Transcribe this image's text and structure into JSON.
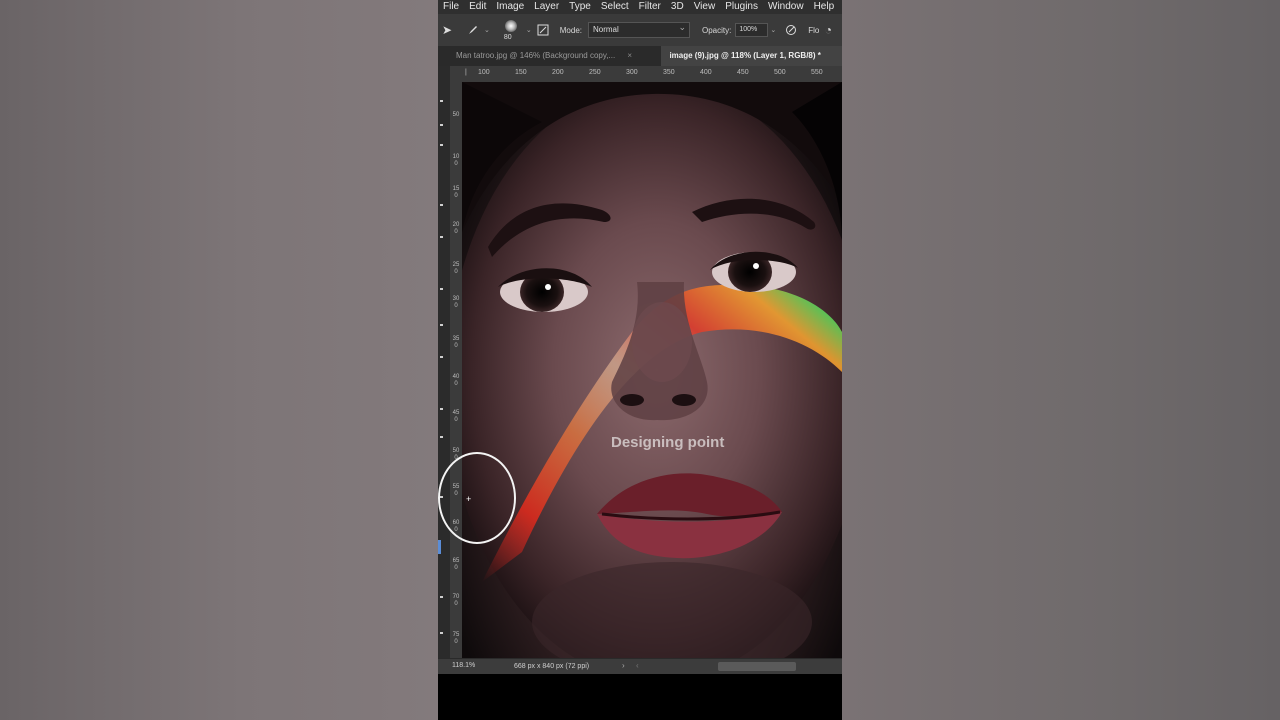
{
  "menubar": {
    "items": [
      "File",
      "Edit",
      "Image",
      "Layer",
      "Type",
      "Select",
      "Filter",
      "3D",
      "View",
      "Plugins",
      "Window",
      "Help"
    ],
    "minimize": "—"
  },
  "options": {
    "brush_size": "80",
    "mode_label": "Mode:",
    "mode_value": "Normal",
    "opacity_label": "Opacity:",
    "opacity_value": "100%",
    "flow_label": "Flo"
  },
  "tabs": [
    {
      "label": "Man tatroo.jpg @ 146% (Background copy,...",
      "close": "×",
      "active": false
    },
    {
      "label": "image (9).jpg @ 118% (Layer 1, RGB/8) *",
      "active": true
    }
  ],
  "ruler_top": [
    "100",
    "150",
    "200",
    "250",
    "300",
    "350",
    "400",
    "450",
    "500",
    "550"
  ],
  "ruler_left": [
    "50",
    "100",
    "150",
    "200",
    "250",
    "300",
    "350",
    "400",
    "450",
    "500",
    "550",
    "600",
    "650",
    "700",
    "750"
  ],
  "canvas": {
    "watermark": "Designing point"
  },
  "statusbar": {
    "zoom": "118.1%",
    "doc_info": "668 px x 840 px (72 ppi)",
    "arrow": "›",
    "arrow_left": "‹"
  },
  "colors": {
    "ui_dark": "#2f2f2f",
    "panel": "#3a3a3a",
    "active_tab": "#434343",
    "accent_blue": "#5b8dd6"
  }
}
